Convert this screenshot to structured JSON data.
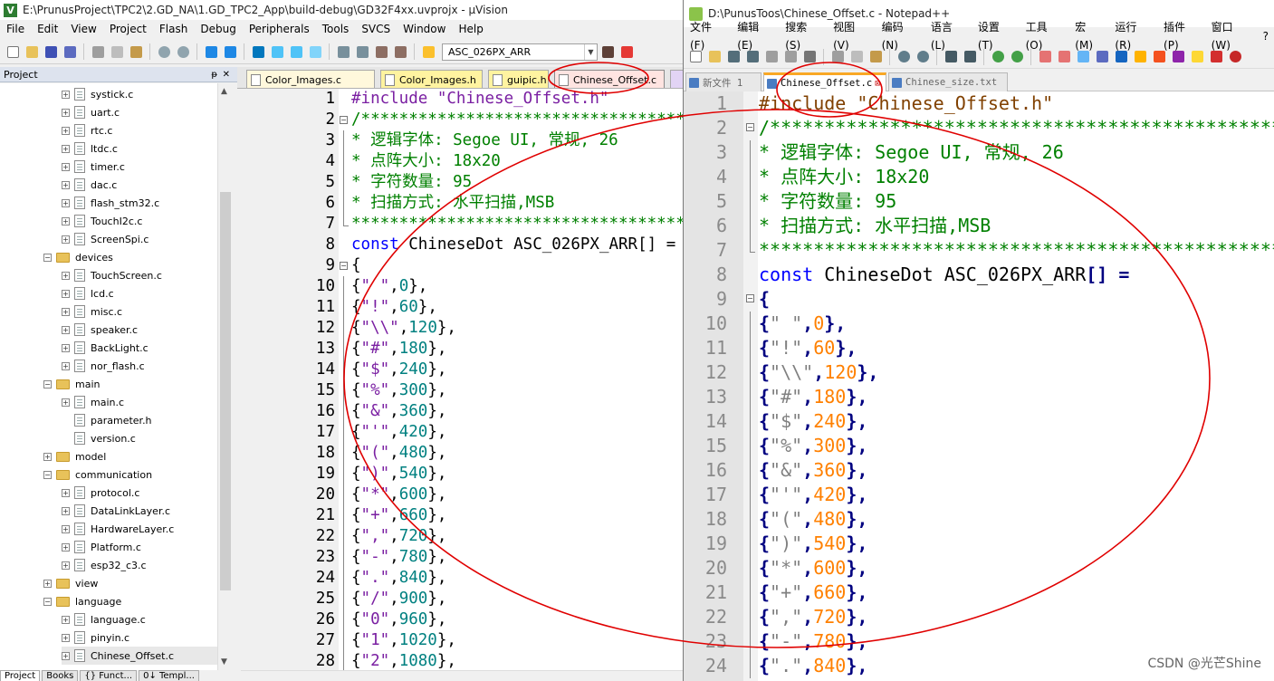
{
  "uvision": {
    "title": "E:\\PrunusProject\\TPC2\\2.GD_NA\\1.GD_TPC2_App\\build-debug\\GD32F4xx.uvprojx - µVision",
    "menu": [
      "File",
      "Edit",
      "View",
      "Project",
      "Flash",
      "Debug",
      "Peripherals",
      "Tools",
      "SVCS",
      "Window",
      "Help"
    ],
    "target_combo": "ASC_026PX_ARR",
    "project_panel_title": "Project",
    "tree": [
      {
        "type": "file",
        "label": "systick.c",
        "depth": 2
      },
      {
        "type": "file",
        "label": "uart.c",
        "depth": 2
      },
      {
        "type": "file",
        "label": "rtc.c",
        "depth": 2
      },
      {
        "type": "file",
        "label": "ltdc.c",
        "depth": 2
      },
      {
        "type": "file",
        "label": "timer.c",
        "depth": 2
      },
      {
        "type": "file",
        "label": "dac.c",
        "depth": 2
      },
      {
        "type": "file",
        "label": "flash_stm32.c",
        "depth": 2
      },
      {
        "type": "file",
        "label": "TouchI2c.c",
        "depth": 2
      },
      {
        "type": "file",
        "label": "ScreenSpi.c",
        "depth": 2
      },
      {
        "type": "folder",
        "label": "devices",
        "depth": 1,
        "open": true
      },
      {
        "type": "file",
        "label": "TouchScreen.c",
        "depth": 2
      },
      {
        "type": "file",
        "label": "lcd.c",
        "depth": 2
      },
      {
        "type": "file",
        "label": "misc.c",
        "depth": 2
      },
      {
        "type": "file",
        "label": "speaker.c",
        "depth": 2
      },
      {
        "type": "file",
        "label": "BackLight.c",
        "depth": 2
      },
      {
        "type": "file",
        "label": "nor_flash.c",
        "depth": 2
      },
      {
        "type": "folder",
        "label": "main",
        "depth": 1,
        "open": true
      },
      {
        "type": "file",
        "label": "main.c",
        "depth": 2
      },
      {
        "type": "file",
        "label": "parameter.h",
        "depth": 2,
        "noexp": true
      },
      {
        "type": "file",
        "label": "version.c",
        "depth": 2,
        "noexp": true
      },
      {
        "type": "folder",
        "label": "model",
        "depth": 1,
        "open": false
      },
      {
        "type": "folder",
        "label": "communication",
        "depth": 1,
        "open": true
      },
      {
        "type": "file",
        "label": "protocol.c",
        "depth": 2
      },
      {
        "type": "file",
        "label": "DataLinkLayer.c",
        "depth": 2
      },
      {
        "type": "file",
        "label": "HardwareLayer.c",
        "depth": 2
      },
      {
        "type": "file",
        "label": "Platform.c",
        "depth": 2
      },
      {
        "type": "file",
        "label": "esp32_c3.c",
        "depth": 2
      },
      {
        "type": "folder",
        "label": "view",
        "depth": 1,
        "open": false
      },
      {
        "type": "folder",
        "label": "language",
        "depth": 1,
        "open": true
      },
      {
        "type": "file",
        "label": "language.c",
        "depth": 2
      },
      {
        "type": "file",
        "label": "pinyin.c",
        "depth": 2
      },
      {
        "type": "file",
        "label": "Chinese_Offset.c",
        "depth": 2,
        "selected": true
      }
    ],
    "panel_tabs": [
      "Project",
      "Books",
      "{} Funct...",
      "0↓ Templ..."
    ],
    "editor_tabs": [
      {
        "label": "Color_Images.c",
        "color": "#fff8dc"
      },
      {
        "label": "Color_Images.h",
        "color": "#fff3a0"
      },
      {
        "label": "guipic.h",
        "color": "#fff3a0"
      },
      {
        "label": "Chinese_Offset.c",
        "color": "#ffe4e1",
        "active": true
      }
    ]
  },
  "notepad": {
    "title": "D:\\PunusToos\\Chinese_Offset.c - Notepad++",
    "menu": [
      "文件(F)",
      "编辑(E)",
      "搜索(S)",
      "视图(V)",
      "编码(N)",
      "语言(L)",
      "设置(T)",
      "工具(O)",
      "宏(M)",
      "运行(R)",
      "插件(P)",
      "窗口(W)",
      "?"
    ],
    "tabs": [
      {
        "label": "新文件 1",
        "active": false
      },
      {
        "label": "Chinese_Offset.c",
        "active": true
      },
      {
        "label": "Chinese_size.txt",
        "active": false
      }
    ]
  },
  "code": {
    "include": "#include \"Chinese_Offset.h\"",
    "comment_start": "/***************************************************",
    "comment_lines": [
      "* 逻辑字体: Segoe UI, 常规, 26",
      "* 点阵大小: 18x20",
      "* 字符数量: 95",
      "* 扫描方式: 水平扫描,MSB"
    ],
    "comment_end": "****************************************************",
    "decl_kw": "const",
    "decl_rest": " ChineseDot ASC_026PX_ARR",
    "decl_br": "[]",
    "decl_eq": " =",
    "open_brace": "{",
    "entries": [
      [
        "\" \"",
        "0"
      ],
      [
        "\"!\"",
        "60"
      ],
      [
        "\"\\\\\"",
        "120"
      ],
      [
        "\"#\"",
        "180"
      ],
      [
        "\"$\"",
        "240"
      ],
      [
        "\"%\"",
        "300"
      ],
      [
        "\"&\"",
        "360"
      ],
      [
        "\"'\"",
        "420"
      ],
      [
        "\"(\"",
        "480"
      ],
      [
        "\")\"",
        "540"
      ],
      [
        "\"*\"",
        "600"
      ],
      [
        "\"+\"",
        "660"
      ],
      [
        "\",\"",
        "720"
      ],
      [
        "\"-\"",
        "780"
      ],
      [
        "\".\"",
        "840"
      ],
      [
        "\"/\"",
        "900"
      ],
      [
        "\"0\"",
        "960"
      ],
      [
        "\"1\"",
        "1020"
      ],
      [
        "\"2\"",
        "1080"
      ]
    ]
  },
  "watermark": "CSDN @光芒Shine",
  "annotation_color": "#e00000"
}
